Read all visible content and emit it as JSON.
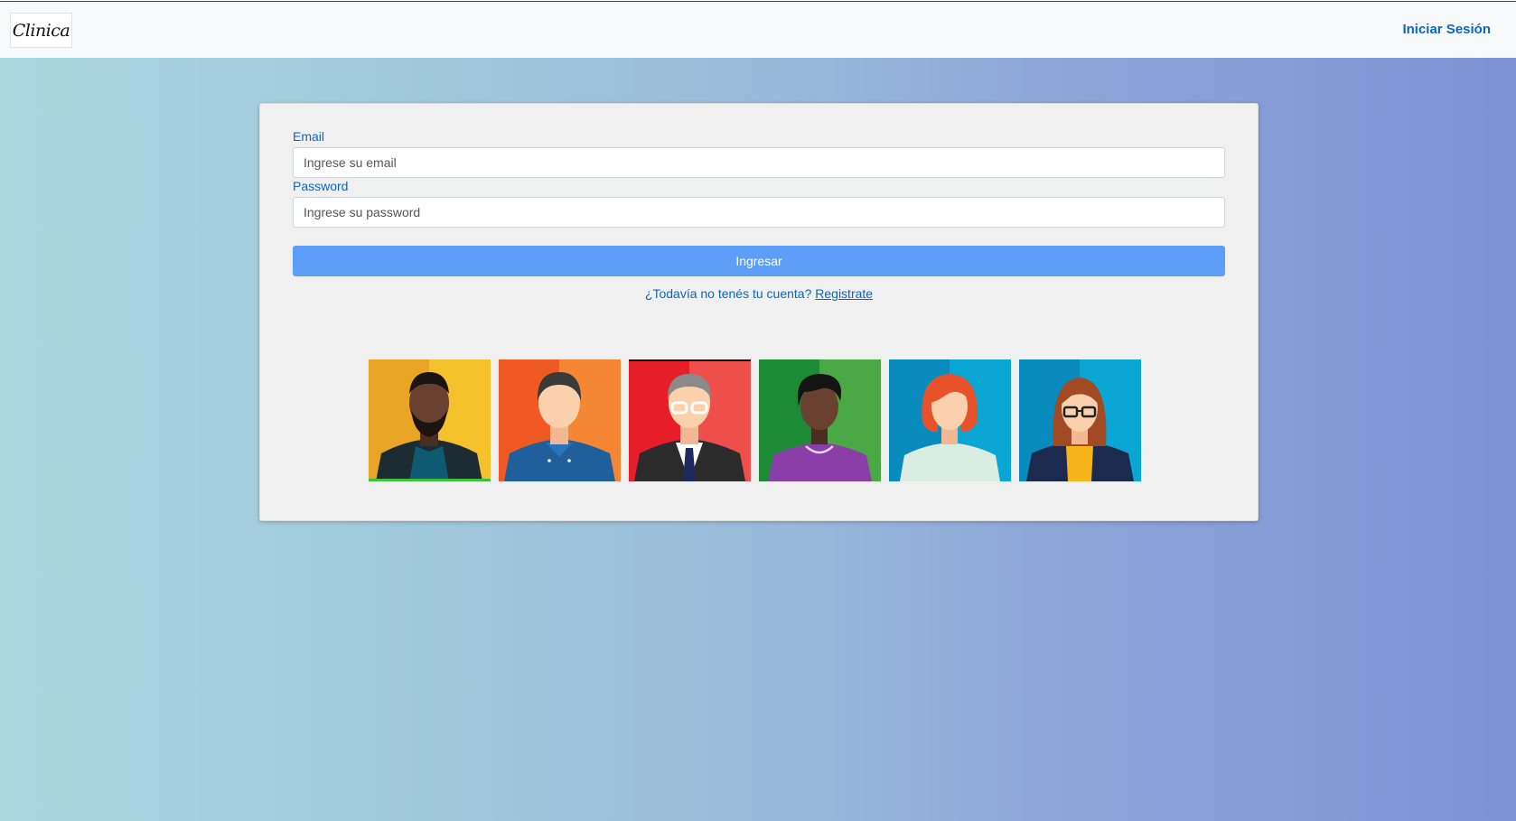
{
  "navbar": {
    "brand": "Clinica",
    "login_link": "Iniciar Sesión"
  },
  "form": {
    "email_label": "Email",
    "email_placeholder": "Ingrese su email",
    "password_label": "Password",
    "password_placeholder": "Ingrese su password",
    "submit_label": "Ingresar",
    "register_prompt": "¿Todavía no tenés tu cuenta?",
    "register_link": "Registrate"
  },
  "colors": {
    "accent": "#0a66c2",
    "button": "#5d9ef8",
    "card_bg": "#f0f0f0"
  },
  "quick_access_avatars": [
    {
      "icon": "man-beard-avatar-icon",
      "bg": "#f5b81f"
    },
    {
      "icon": "man-blue-shirt-avatar-icon",
      "bg": "#f26b2d"
    },
    {
      "icon": "man-suit-glasses-avatar-icon",
      "bg": "#ea3a3e"
    },
    {
      "icon": "woman-curly-hair-avatar-icon",
      "bg": "#2f9a3f"
    },
    {
      "icon": "woman-red-hair-avatar-icon",
      "bg": "#0aa0cf"
    },
    {
      "icon": "woman-glasses-avatar-icon",
      "bg": "#0aa0cf"
    }
  ]
}
